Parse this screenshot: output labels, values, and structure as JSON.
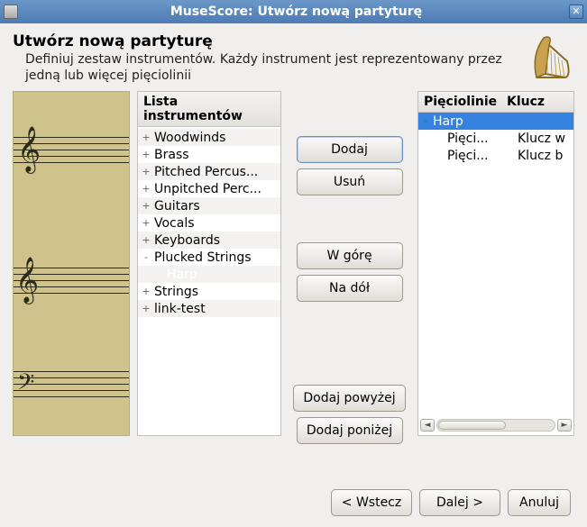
{
  "window": {
    "title": "MuseScore: Utwórz nową partyturę"
  },
  "header": {
    "title": "Utwórz nową partyturę",
    "subtitle": "Definiuj zestaw instrumentów. Każdy instrument jest reprezentowany przez jedną lub więcej pięciolinii"
  },
  "left_panel": {
    "title": "Lista instrumentów",
    "items": [
      {
        "label": "Woodwinds",
        "expand": "+",
        "depth": 0
      },
      {
        "label": "Brass",
        "expand": "+",
        "depth": 0
      },
      {
        "label": "Pitched Percus...",
        "expand": "+",
        "depth": 0
      },
      {
        "label": "Unpitched Perc...",
        "expand": "+",
        "depth": 0
      },
      {
        "label": "Guitars",
        "expand": "+",
        "depth": 0
      },
      {
        "label": "Vocals",
        "expand": "+",
        "depth": 0
      },
      {
        "label": "Keyboards",
        "expand": "+",
        "depth": 0
      },
      {
        "label": "Plucked Strings",
        "expand": "-",
        "depth": 0
      },
      {
        "label": "Harp",
        "expand": "",
        "depth": 1,
        "selected": true
      },
      {
        "label": "Strings",
        "expand": "+",
        "depth": 0
      },
      {
        "label": "link-test",
        "expand": "+",
        "depth": 0
      }
    ]
  },
  "buttons": {
    "add": "Dodaj",
    "remove": "Usuń",
    "up": "W górę",
    "down": "Na dół",
    "add_above": "Dodaj powyżej",
    "add_below": "Dodaj poniżej"
  },
  "right_panel": {
    "col1": "Pięciolinie",
    "col2": "Klucz",
    "rows": [
      {
        "c1": "Harp",
        "c2": "",
        "expand": "-",
        "depth": 0,
        "selected": true
      },
      {
        "c1": "Pięci...",
        "c2": "Klucz w",
        "expand": "",
        "depth": 1
      },
      {
        "c1": "Pięci...",
        "c2": "Klucz b",
        "expand": "",
        "depth": 1
      }
    ]
  },
  "footer": {
    "back": "< Wstecz",
    "next": "Dalej >",
    "cancel": "Anuluj"
  }
}
